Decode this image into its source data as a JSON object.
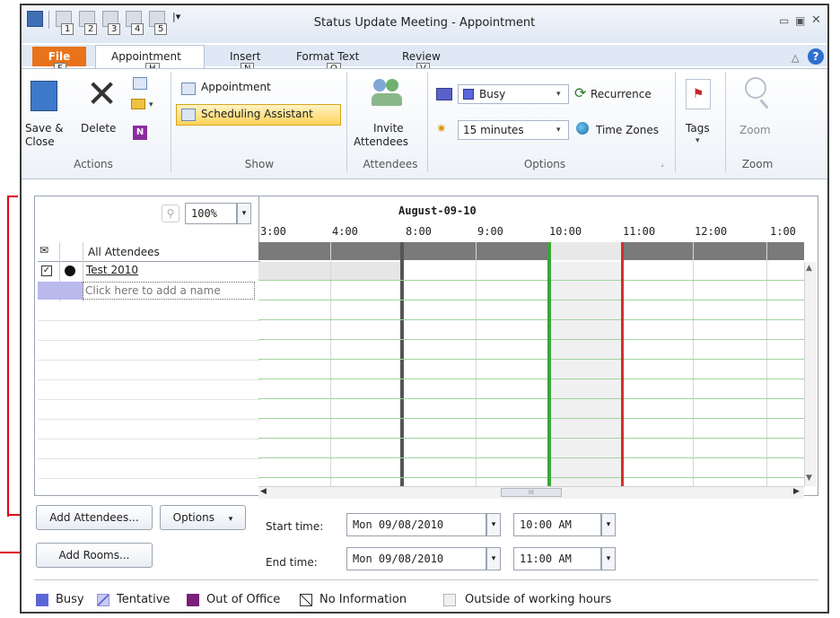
{
  "window": {
    "title": "Status Update Meeting - Appointment"
  },
  "qat": {
    "keytips": [
      "1",
      "2",
      "3",
      "4",
      "5"
    ]
  },
  "tabs": [
    {
      "label": "File",
      "keytip": "F"
    },
    {
      "label": "Appointment",
      "keytip": "H"
    },
    {
      "label": "Insert",
      "keytip": "N"
    },
    {
      "label": "Format Text",
      "keytip": "O"
    },
    {
      "label": "Review",
      "keytip": "V"
    }
  ],
  "ribbon": {
    "actions": {
      "save_close": "Save &\nClose",
      "save_line1": "Save &",
      "save_line2": "Close",
      "delete": "Delete",
      "group": "Actions"
    },
    "show": {
      "appointment": "Appointment",
      "scheduling_assistant": "Scheduling Assistant",
      "group": "Show"
    },
    "attendees": {
      "invite_line1": "Invite",
      "invite_line2": "Attendees",
      "group": "Attendees"
    },
    "options": {
      "show_as": "Busy",
      "reminder": "15 minutes",
      "recurrence": "Recurrence",
      "time_zones": "Time Zones",
      "group": "Options"
    },
    "tags": {
      "label": "Tags"
    },
    "zoom": {
      "label": "Zoom",
      "group": "Zoom"
    }
  },
  "scheduler": {
    "zoom_value": "100%",
    "date_header": "August-09-10",
    "time_ticks": [
      "3:00",
      "4:00",
      "8:00",
      "9:00",
      "10:00",
      "11:00",
      "12:00",
      "1:00"
    ],
    "all_attendees_label": "All Attendees",
    "attendees": [
      {
        "name": "Test 2010",
        "checked": true
      }
    ],
    "add_name_placeholder": "Click here to add a name",
    "scroll_thumb": "III"
  },
  "bottom": {
    "add_attendees": "Add Attendees...",
    "options": "Options",
    "add_rooms": "Add Rooms...",
    "start_label": "Start time:",
    "start_date": "Mon 09/08/2010",
    "start_time": "10:00 AM",
    "end_label": "End time:",
    "end_date": "Mon 09/08/2010",
    "end_time": "11:00 AM"
  },
  "legend": [
    {
      "label": "Busy",
      "color": "#5b67d6"
    },
    {
      "label": "Tentative",
      "color": "#c9ccf2"
    },
    {
      "label": "Out of Office",
      "color": "#7a1f7a"
    },
    {
      "label": "No Information",
      "color": "#ffffff"
    },
    {
      "label": "Outside of working hours",
      "color": "#f0f0f0"
    }
  ],
  "colors": {
    "start_line": "#3aa63a",
    "end_line": "#d32f2f",
    "busy_bar": "#7a7a7a",
    "annotation": "#e0001a"
  }
}
